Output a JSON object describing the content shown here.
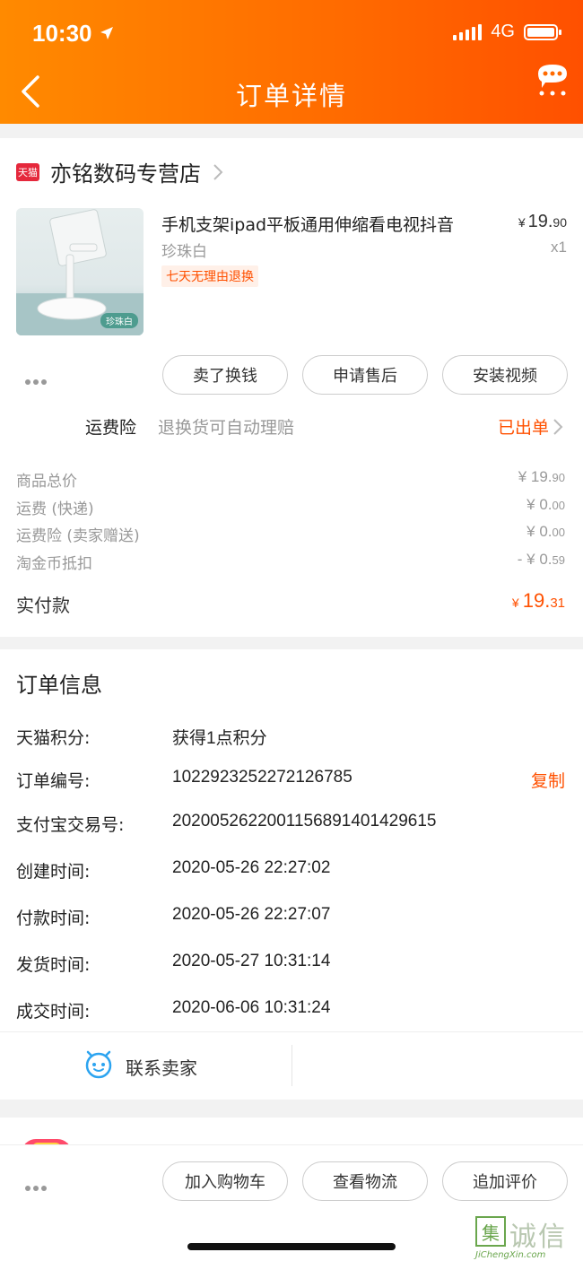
{
  "status_bar": {
    "time": "10:30",
    "network": "4G"
  },
  "nav": {
    "title": "订单详情"
  },
  "shop": {
    "badge": "天猫",
    "name": "亦铭数码专营店"
  },
  "product": {
    "title": "手机支架ipad平板通用伸缩看电视抖音",
    "sku": "珍珠白",
    "thumb_tag": "珍珠白",
    "service_tag": "七天无理由退换",
    "price_currency": "¥",
    "price_int": "19.",
    "price_dec": "90",
    "quantity": "x1"
  },
  "item_actions": [
    "卖了换钱",
    "申请售后",
    "安装视频"
  ],
  "insurance": {
    "label": "运费险",
    "desc": "退换货可自动理赔",
    "status": "已出单"
  },
  "fees": [
    {
      "label": "商品总价",
      "int": "¥ 19.",
      "dec": "90"
    },
    {
      "label": "运费 (快递)",
      "int": "¥ 0.",
      "dec": "00"
    },
    {
      "label": "运费险 (卖家赠送)",
      "int": "¥ 0.",
      "dec": "00"
    },
    {
      "label": "淘金币抵扣",
      "int": "- ¥ 0.",
      "dec": "59"
    }
  ],
  "total": {
    "label": "实付款",
    "currency": "¥",
    "int": "19.",
    "dec": "31"
  },
  "order_info": {
    "title": "订单信息",
    "rows": [
      {
        "key": "天猫积分:",
        "value": "获得1点积分"
      },
      {
        "key": "订单编号:",
        "value": "1022923252272126785",
        "action": "复制"
      },
      {
        "key": "支付宝交易号:",
        "value": "2020052622001156891401429615"
      },
      {
        "key": "创建时间:",
        "value": "2020-05-26 22:27:02"
      },
      {
        "key": "付款时间:",
        "value": "2020-05-26 22:27:07"
      },
      {
        "key": "发货时间:",
        "value": "2020-05-27 10:31:14"
      },
      {
        "key": "成交时间:",
        "value": "2020-06-06 10:31:24"
      }
    ],
    "contact": "联系卖家"
  },
  "bottom_actions": [
    "加入购物车",
    "查看物流",
    "追加评价"
  ],
  "watermark": {
    "logo": "集",
    "cn": "诚信",
    "en": "JiChengXin.com"
  }
}
